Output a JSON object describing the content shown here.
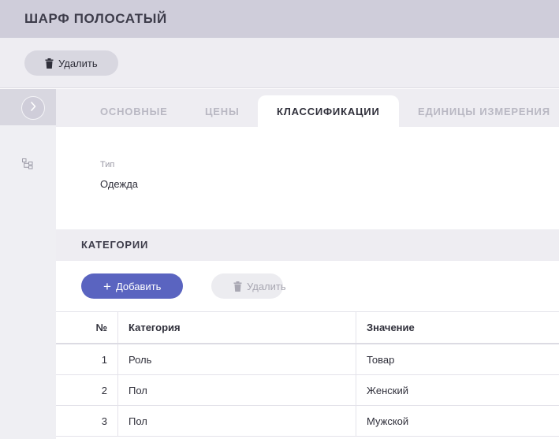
{
  "header": {
    "title": "ШАРФ ПОЛОСАТЫЙ"
  },
  "toolbar": {
    "delete_label": "Удалить"
  },
  "tabs": [
    {
      "label": "ОСНОВНЫЕ",
      "active": false
    },
    {
      "label": "ЦЕНЫ",
      "active": false
    },
    {
      "label": "КЛАССИФИКАЦИИ",
      "active": true
    },
    {
      "label": "ЕДИНИЦЫ ИЗМЕРЕНИЯ",
      "active": false
    }
  ],
  "rail": {
    "expand_icon": "chevron-right-icon",
    "tree_icon": "tree-structure-icon"
  },
  "type_field": {
    "label": "Тип",
    "value": "Одежда"
  },
  "categories": {
    "title": "КАТЕГОРИИ",
    "add_label": "Добавить",
    "delete_label": "Удалить",
    "columns": [
      "№",
      "Категория",
      "Значение"
    ],
    "rows": [
      {
        "num": "1",
        "category": "Роль",
        "value": "Товар"
      },
      {
        "num": "2",
        "category": "Пол",
        "value": "Женский"
      },
      {
        "num": "3",
        "category": "Пол",
        "value": "Мужской"
      }
    ]
  },
  "colors": {
    "accent": "#5a64c0",
    "header_bg": "#cfcdda",
    "panel_bg": "#eeedf2"
  }
}
